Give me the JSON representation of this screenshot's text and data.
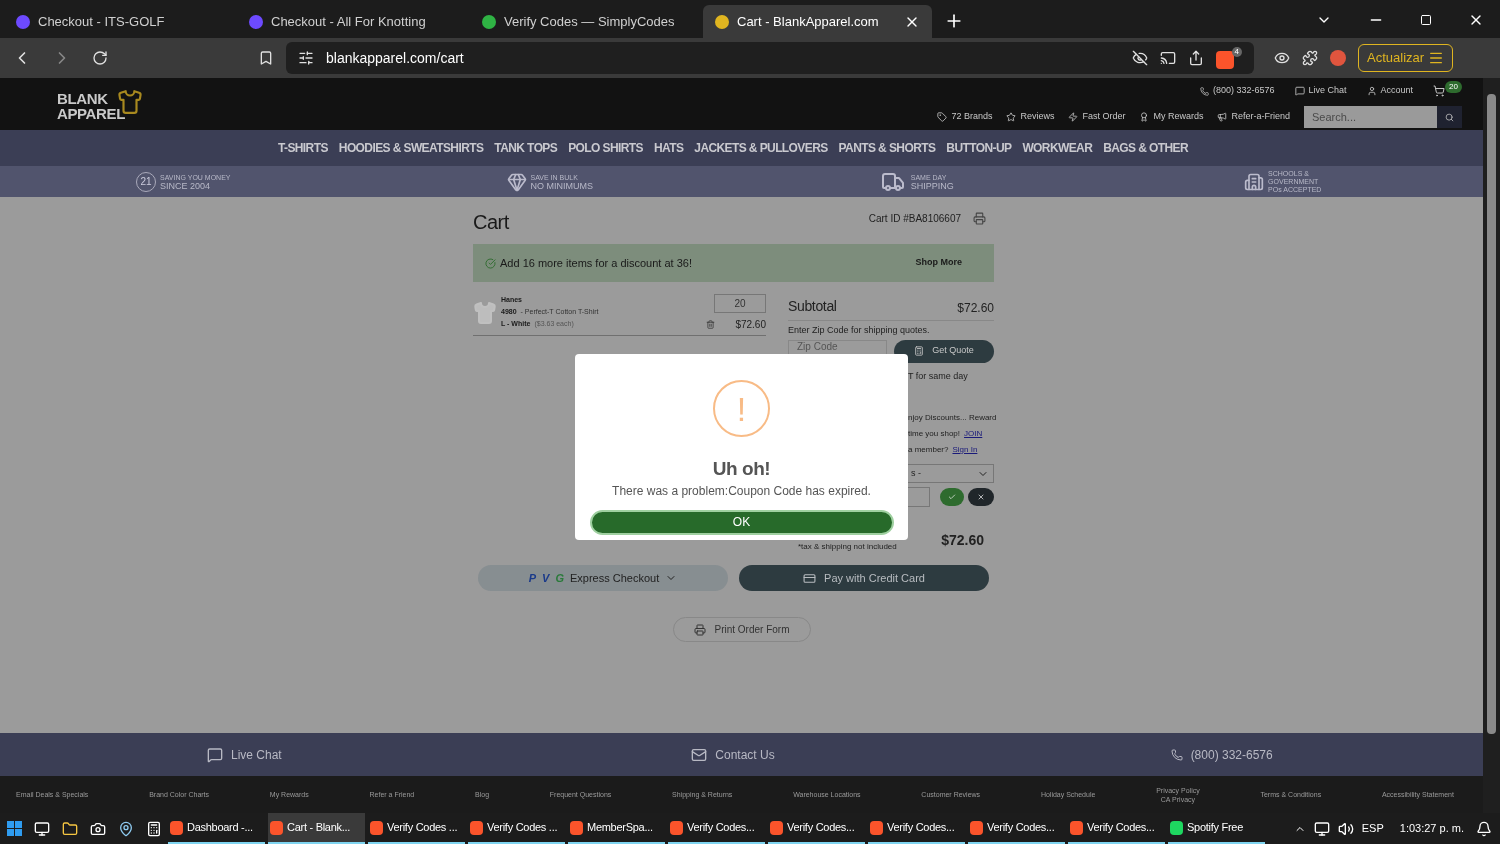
{
  "browser": {
    "tabs": [
      {
        "title": "Checkout - ITS-GOLF",
        "selected": false
      },
      {
        "title": "Checkout - All For Knotting",
        "selected": false
      },
      {
        "title": "Verify Codes — SimplyCodes",
        "selected": false
      },
      {
        "title": "Cart - BlankApparel.com",
        "selected": true
      }
    ],
    "url": "blankapparel.com/cart",
    "update_button": "Actualizar",
    "shield_count": "4"
  },
  "site": {
    "logo": [
      "BLANK",
      "APPAREL"
    ],
    "phone": "(800) 332-6576",
    "live_chat": "Live Chat",
    "account": "Account",
    "cart_count": "20",
    "links": [
      "72 Brands",
      "Reviews",
      "Fast Order",
      "My Rewards",
      "Refer-a-Friend"
    ],
    "search_placeholder": "Search...",
    "nav": [
      "T-SHIRTS",
      "HOODIES & SWEATSHIRTS",
      "TANK TOPS",
      "POLO SHIRTS",
      "HATS",
      "JACKETS & PULLOVERS",
      "PANTS & SHORTS",
      "BUTTON-UP",
      "WORKWEAR",
      "BAGS & OTHER"
    ],
    "banners": [
      {
        "kind": "medal",
        "badge": "21",
        "lines": [
          "SAVING YOU MONEY",
          "SINCE 2004"
        ]
      },
      {
        "kind": "diamond",
        "lines": [
          "SAVE IN BULK",
          "NO MINIMUMS"
        ]
      },
      {
        "kind": "truck",
        "lines": [
          "SAME DAY",
          "SHIPPING"
        ]
      },
      {
        "kind": "building",
        "lines": [
          "SCHOOLS &",
          "GOVERNMENT",
          "POs ACCEPTED"
        ]
      }
    ]
  },
  "cart": {
    "title": "Cart",
    "cart_id": "Cart ID #BA8106607",
    "notice": "Add 16 more items for a discount at 36!",
    "shop_more": "Shop More",
    "item": {
      "brand": "Hanes",
      "code": "4980",
      "name": "- Perfect-T Cotton T-Shirt",
      "variant": "L - White",
      "each": "($3.63 each)",
      "qty": "20",
      "price": "$72.60"
    },
    "summary": {
      "subtotal_label": "Subtotal",
      "subtotal": "$72.60",
      "zip_prompt": "Enter Zip Code for shipping quotes.",
      "zip_placeholder": "Zip Code",
      "get_quote": "Get Quote",
      "same_day": "T for same day",
      "rewards_1": "njoy Discounts... Reward",
      "rewards_2": "time you shop!",
      "join": "JOIN",
      "rewards_3": "a member?",
      "sign_in": "Sign In",
      "select": "s -",
      "total": "$72.60",
      "total_note": "*tax & shipping not included"
    },
    "express_marks": [
      "P",
      "V",
      "G"
    ],
    "express_checkout": "Express Checkout",
    "pay_card": "Pay with Credit Card",
    "print_form": "Print Order Form"
  },
  "modal": {
    "icon": "!",
    "title": "Uh oh!",
    "message": "There was a problem:Coupon Code has expired.",
    "ok": "OK"
  },
  "footer": {
    "bar": [
      {
        "kind": "chat",
        "label": "Live Chat"
      },
      {
        "kind": "mail",
        "label": "Contact Us"
      },
      {
        "kind": "phone",
        "label": "(800) 332-6576"
      }
    ],
    "links": [
      {
        "text": "Email Deals & Specials"
      },
      {
        "text": "Brand Color Charts"
      },
      {
        "text": "My Rewards"
      },
      {
        "text": "Refer a Friend"
      },
      {
        "text": "Blog"
      },
      {
        "text": "Frequent Questions"
      },
      {
        "text": "Shipping & Returns"
      },
      {
        "text": "Warehouse Locations"
      },
      {
        "text": "Customer Reviews"
      },
      {
        "text": "Holiday Schedule"
      },
      {
        "text": "Privacy Policy",
        "sub": "CA Privacy"
      },
      {
        "text": "Terms & Conditions"
      },
      {
        "text": "Accessibility Statement"
      }
    ]
  },
  "taskbar": {
    "apps": [
      {
        "label": "Dashboard -...",
        "selected": false
      },
      {
        "label": "Cart - Blank...",
        "selected": true
      },
      {
        "label": "Verify Codes ...",
        "selected": false
      },
      {
        "label": "Verify Codes ...",
        "selected": false
      },
      {
        "label": "MemberSpa...",
        "selected": false
      },
      {
        "label": "Verify Codes...",
        "selected": false
      },
      {
        "label": "Verify Codes...",
        "selected": false
      },
      {
        "label": "Verify Codes...",
        "selected": false
      },
      {
        "label": "Verify Codes...",
        "selected": false
      },
      {
        "label": "Verify Codes...",
        "selected": false
      },
      {
        "label": "Spotify Free",
        "selected": false
      }
    ],
    "lang": "ESP",
    "time": "1:03:27 p. m."
  }
}
